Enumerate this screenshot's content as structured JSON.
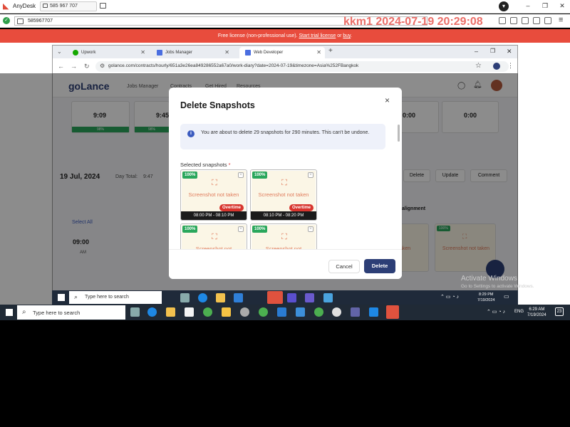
{
  "anydesk": {
    "app_name": "AnyDesk",
    "tab_label": "585 967 707",
    "address": "585967707",
    "watermark": "kkm1 2024-07-19 20:29:08",
    "banner_text": "Free license (non-professional use).",
    "banner_link1": "Start trial license",
    "banner_or": "or",
    "banner_link2": "buy",
    "banner_end": "."
  },
  "browser": {
    "tabs": [
      {
        "label": "Upwork",
        "color": "#14a800"
      },
      {
        "label": "Jobs Manager",
        "color": "#4a6ee0"
      },
      {
        "label": "Web Developer",
        "color": "#4a6ee0"
      }
    ],
    "url": "golance.com/contracts/hourly/651a3e26ea849286552a67a0/work-diary?date=2024-07-19&timezone=Asia%252FBangkok"
  },
  "page": {
    "logo": "goLance",
    "nav": [
      "Jobs Manager",
      "Contracts",
      "Get Hired",
      "Resources"
    ],
    "times_top": [
      "9:09",
      "9:45",
      "0:00",
      "0:00"
    ],
    "pct_top": [
      "98%",
      "98%"
    ],
    "date": "19 Jul, 2024",
    "day_total_label": "Day Total:",
    "day_total": "9:47",
    "actions": [
      "Delete",
      "Update",
      "Comment"
    ],
    "select_all": "Select All",
    "hour": "09:00",
    "ampm": "AM",
    "alignment": "alignment",
    "bg_snaps": [
      {
        "pct": "100%",
        "msg": "Screenshot not taken"
      }
    ],
    "bg_partial_msg": "taken"
  },
  "modal": {
    "title": "Delete Snapshots",
    "close": "×",
    "info": "You are about to delete 29 snapshots for 290 minutes. This can't be undone.",
    "selected_label": "Selected snapshots",
    "required_mark": "*",
    "snapshots": [
      {
        "pct": "100%",
        "msg": "Screenshot not taken",
        "overtime": "Overtime",
        "range": "08:00 PM - 08:10 PM"
      },
      {
        "pct": "100%",
        "msg": "Screenshot not taken",
        "overtime": "Overtime",
        "range": "08:10 PM - 08:20 PM"
      },
      {
        "pct": "100%",
        "msg": "Screenshot not",
        "overtime": "",
        "range": ""
      },
      {
        "pct": "100%",
        "msg": "Screenshot not",
        "overtime": "",
        "range": ""
      }
    ],
    "cancel": "Cancel",
    "delete": "Delete"
  },
  "inner_taskbar": {
    "search": "Type here to search",
    "time": "8:29 PM",
    "date": "7/19/2024"
  },
  "activate": {
    "title": "Activate Windows",
    "sub": "Go to Settings to activate Windows."
  },
  "taskbar": {
    "search": "Type here to search",
    "lang": "ENG",
    "time": "6:29 AM",
    "date": "7/19/2024",
    "notif": "23"
  }
}
